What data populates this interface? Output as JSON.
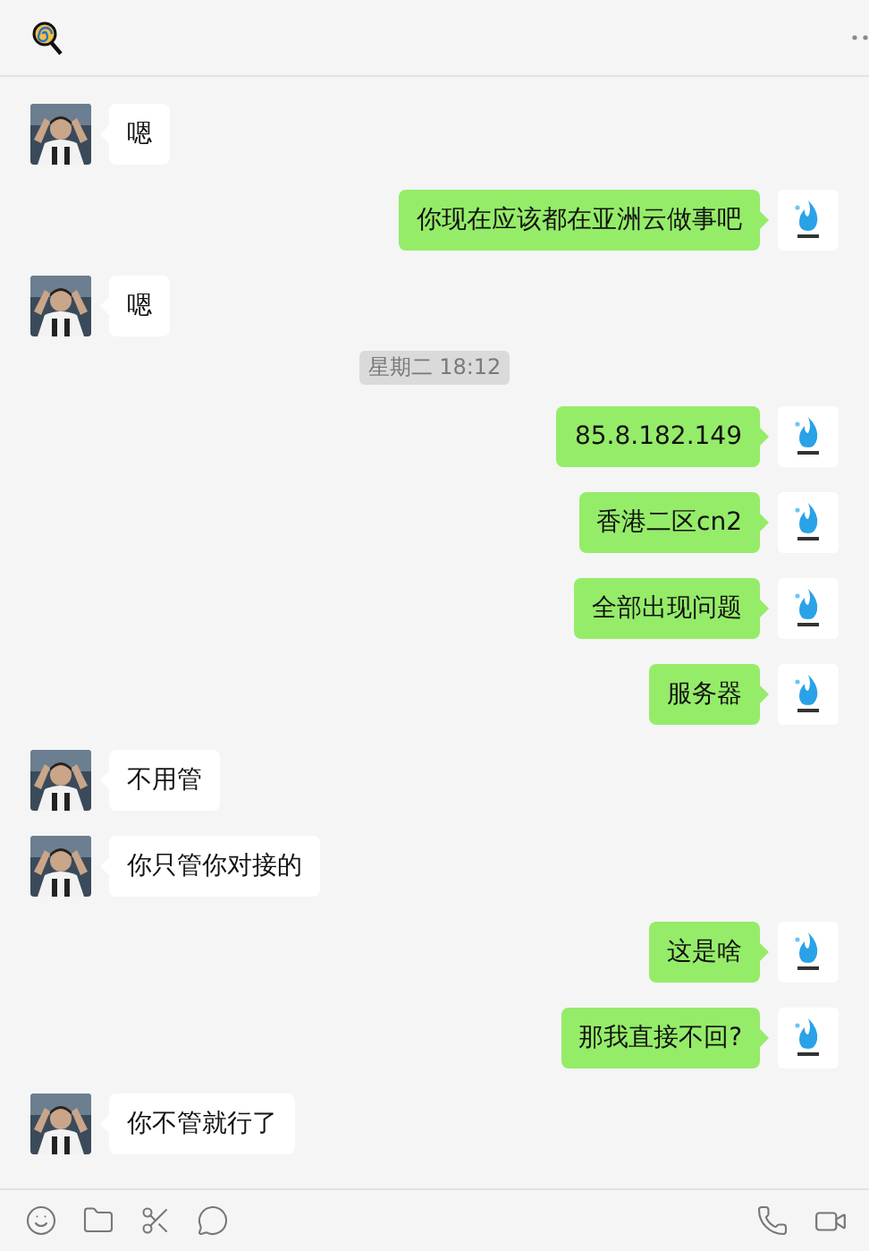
{
  "messages": [
    {
      "kind": "message",
      "outgoing": false,
      "text": "嗯"
    },
    {
      "kind": "message",
      "outgoing": true,
      "text": "你现在应该都在亚洲云做事吧"
    },
    {
      "kind": "message",
      "outgoing": false,
      "text": "嗯"
    },
    {
      "kind": "time",
      "text": "星期二 18:12"
    },
    {
      "kind": "message",
      "outgoing": true,
      "text": "85.8.182.149"
    },
    {
      "kind": "message",
      "outgoing": true,
      "text": "香港二区cn2"
    },
    {
      "kind": "message",
      "outgoing": true,
      "text": "全部出现问题"
    },
    {
      "kind": "message",
      "outgoing": true,
      "text": "服务器"
    },
    {
      "kind": "message",
      "outgoing": false,
      "text": "不用管"
    },
    {
      "kind": "message",
      "outgoing": false,
      "text": "你只管你对接的"
    },
    {
      "kind": "message",
      "outgoing": true,
      "text": "这是啥"
    },
    {
      "kind": "message",
      "outgoing": true,
      "text": "那我直接不回?"
    },
    {
      "kind": "message",
      "outgoing": false,
      "text": "你不管就行了"
    }
  ]
}
